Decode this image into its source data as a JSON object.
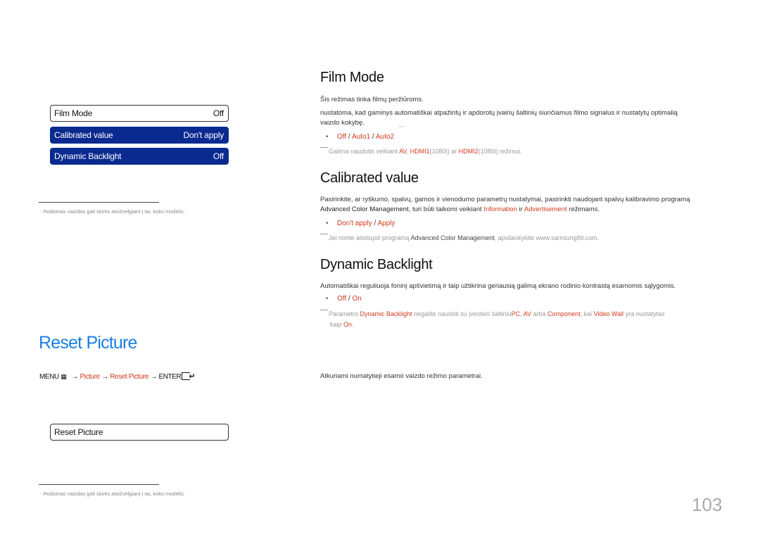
{
  "osd_top": {
    "items": [
      {
        "label": "Film Mode",
        "value": "Off",
        "state": "plain"
      },
      {
        "label": "Calibrated value",
        "value": "Don't apply",
        "state": "selected"
      },
      {
        "label": "Dynamic Backlight",
        "value": "Off",
        "state": "selected"
      }
    ]
  },
  "footnote_top": "- Rodomas vaizdas gali skirtis atsižvelgiant į tai, koks modelis.",
  "sections": {
    "film_mode": {
      "title": "Film Mode",
      "desc1": "Šis režimas tinka filmų peržiūroms.",
      "desc2_line1": "nustatoma, kad gaminys automatiškai atpažintų ir apdorotų įvairių šaltinių siunčiamus filmo signalus ir nustatytų optimalią",
      "desc2_line2": "vaizdo kokybę.",
      "tiny_mark": "xxxx",
      "options": [
        "Off",
        "Auto1",
        "Auto2"
      ],
      "note": {
        "pre": "Galima naudotis veikiant ",
        "av": "AV",
        "sep1": ", ",
        "hdmi1": "HDMI1",
        "hdmi1_res": "(1080i) ar ",
        "hdmi2": "HDMI2",
        "hdmi2_res": "(1080i) režimui."
      }
    },
    "calibrated_value": {
      "title": "Calibrated value",
      "desc_line1": "Pasirinkite, ar ryškumo, spalvų, gamos ir vienodumo parametrų nustatymai, pasirinkti naudojant spalvų kalibravimo programą",
      "desc_line2_app": "Advanced Color Management",
      "desc_line2_mid": ", turi būti taikomi veikiant ",
      "desc_line2_info": "Information",
      "desc_line2_ir": " ir ",
      "desc_line2_adv": "Advertisement",
      "desc_line2_end": " režimams.",
      "options": [
        "Don't apply",
        "Apply"
      ],
      "note": {
        "pre": "Jei norite atsisiųsti programą ",
        "app": "Advanced Color Management",
        "post": ", apsilankykite www.samsunglfd.com."
      }
    },
    "dynamic_backlight": {
      "title": "Dynamic Backlight",
      "desc": "Automatiškai reguliuoja foninį apšvietimą ir taip užtikrina geriausią galimą ekrano rodinio kontrastą esamomis sąlygomis.",
      "options": [
        "Off",
        "On"
      ],
      "note": {
        "pre": "Parametro ",
        "param": "Dynamic Backlight",
        "mid1": " negalite naudoti su įvesties šaltiniu",
        "pc": "PC",
        "sep": ", ",
        "av": "AV",
        "arba": " arba ",
        "component": "Component",
        "kai": ", kai ",
        "video_wall": "Video Wall",
        "yra": " yra nustatytas",
        "kaip": "kaip ",
        "on": "On",
        "end": "."
      }
    }
  },
  "reset_picture": {
    "title": "Reset Picture",
    "menu_path": {
      "menu": "MENU",
      "menu_icon": "menu-icon",
      "arrow": "→",
      "step1": "Picture",
      "step2": "Reset Picture",
      "enter": "ENTER",
      "enter_icon": "enter-icon"
    },
    "desc": "Atkuriami numatytieji esamo vaizdo režimo parametrai.",
    "osd_item": "Reset Picture"
  },
  "footnote_bottom": "- Rodomas vaizdas gali skirtis atsižvelgiant į tai, koks modelis.",
  "page_number": "103",
  "colors": {
    "accent_blue": "#1d7fe3",
    "osd_selected": "#0a2a8f",
    "highlight_red": "#d13a1e"
  }
}
